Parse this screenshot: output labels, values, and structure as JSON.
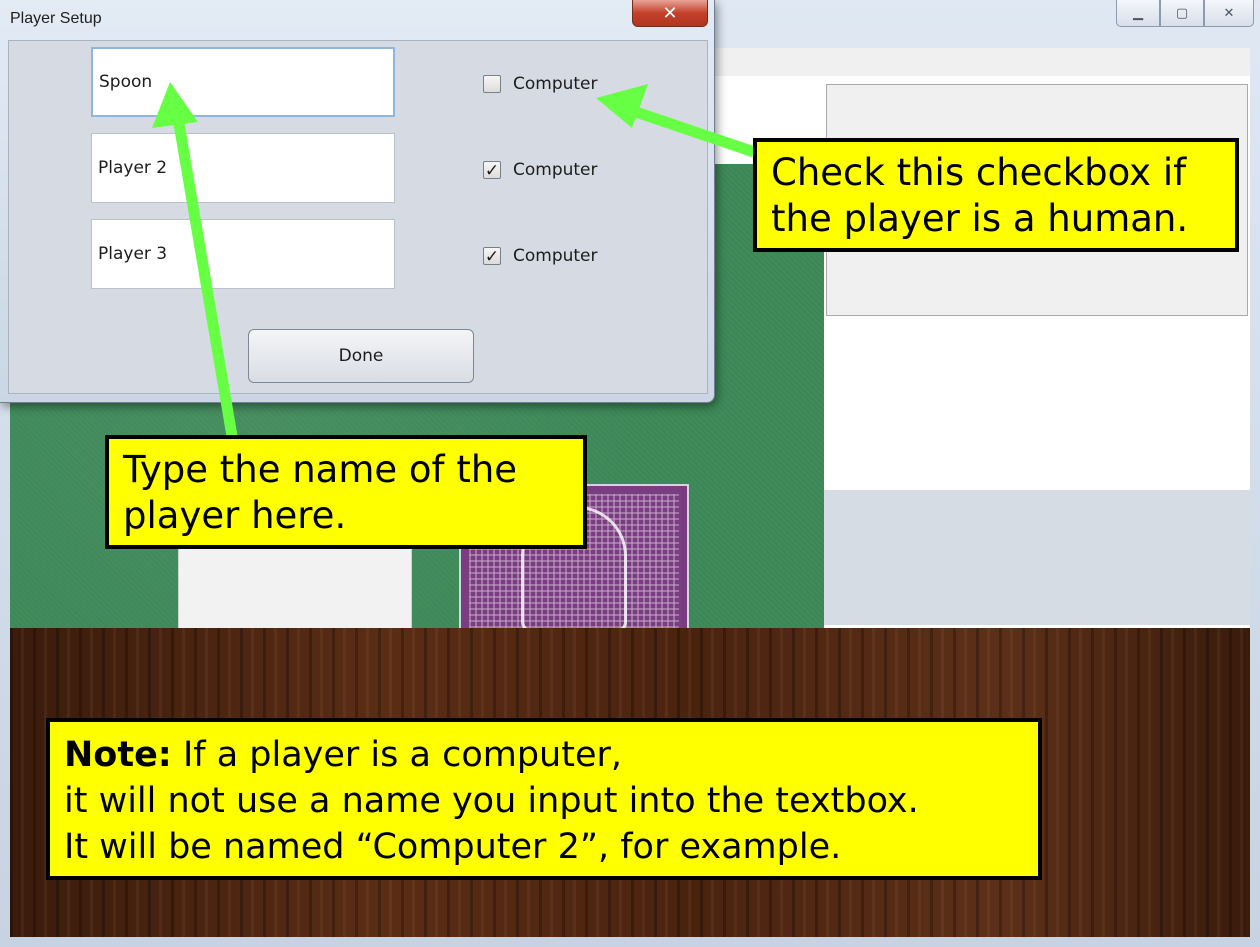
{
  "dialog": {
    "title": "Player Setup",
    "close_glyph": "✕",
    "players": [
      {
        "name": "Spoon",
        "computer_checked": false,
        "computer_label": "Computer"
      },
      {
        "name": "Player 2",
        "computer_checked": true,
        "computer_label": "Computer"
      },
      {
        "name": "Player 3",
        "computer_checked": true,
        "computer_label": "Computer"
      }
    ],
    "done_label": "Done"
  },
  "window_controls": {
    "minimize_icon": "minimize-icon",
    "maximize_icon": "maximize-icon",
    "close_icon": "close-icon"
  },
  "callouts": {
    "checkbox_line1": "Check this checkbox if",
    "checkbox_line2": "the player is a human.",
    "name_line1": "Type the name of the",
    "name_line2": "player here.",
    "note_label": "Note:",
    "note_line1": " If a player is a computer,",
    "note_line2": "it will not use a name you input into the textbox.",
    "note_line3": "It will be named “Computer 2”, for example."
  },
  "colors": {
    "callout_bg": "#ffff00",
    "arrow": "#66ff44",
    "felt": "#3f8b5a",
    "card_back": "#7a3d82"
  }
}
